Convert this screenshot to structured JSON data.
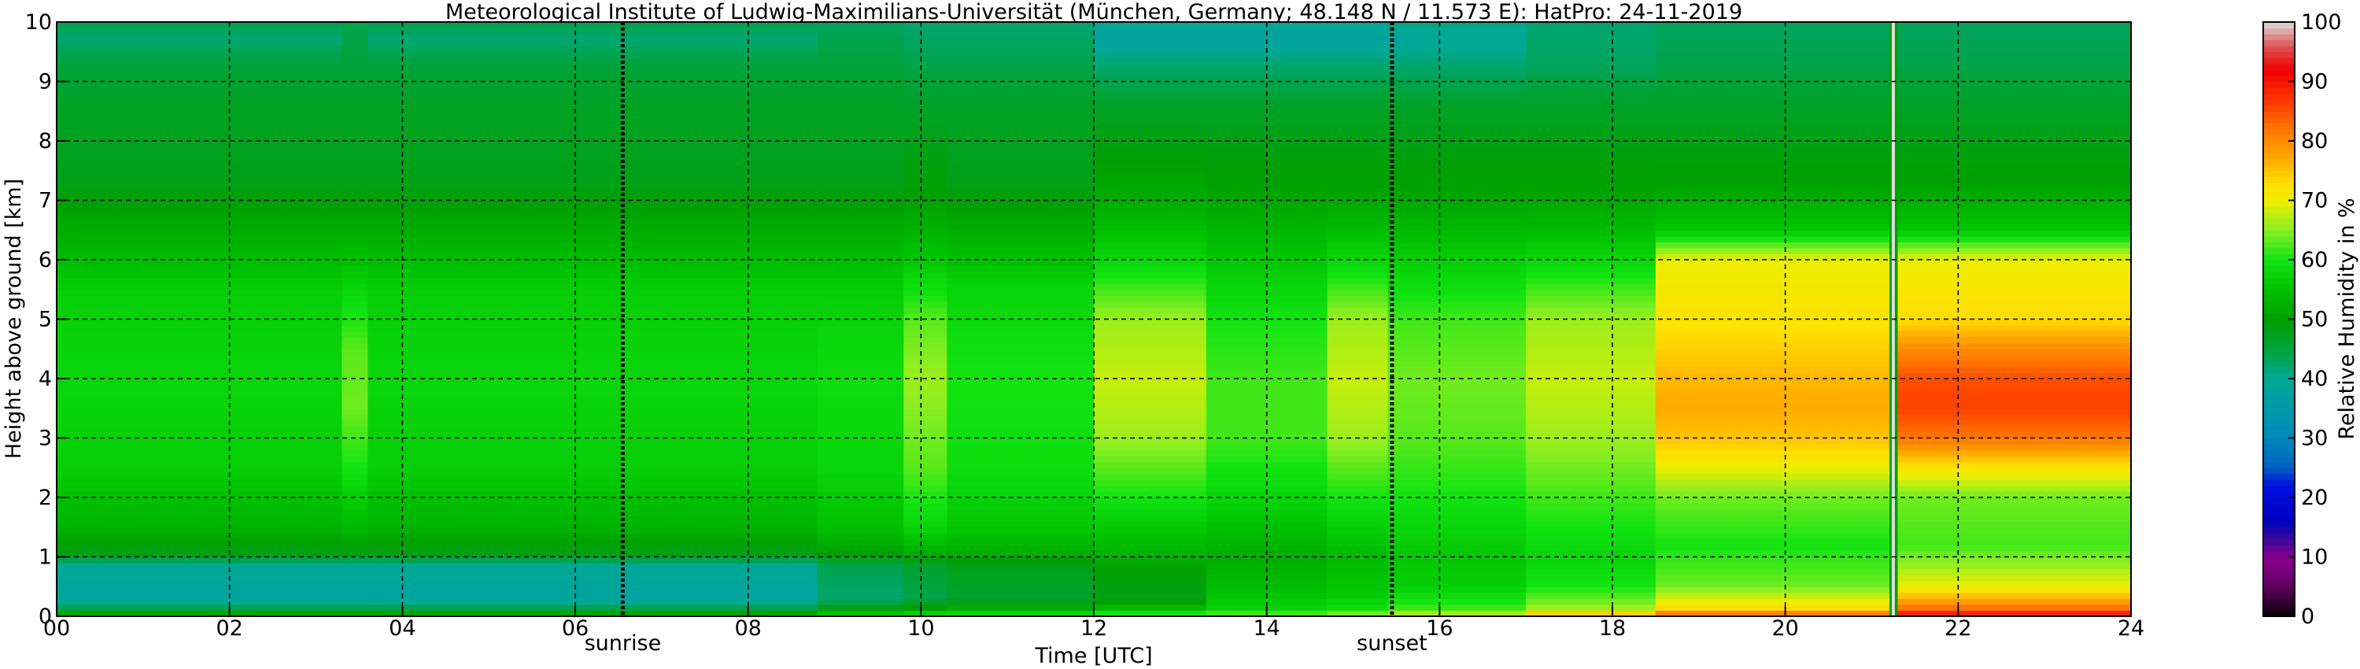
{
  "chart_data": {
    "type": "heatmap",
    "title": "Meteorological Institute of Ludwig-Maximilians-Universität (München, Germany; 48.148 N / 11.573 E):    HatPro: 24-11-2019",
    "xlabel": "Time [UTC]",
    "ylabel": "Height above ground [km]",
    "xlim": [
      0,
      24
    ],
    "ylim": [
      0,
      10
    ],
    "x_ticks": [
      "00",
      "02",
      "04",
      "06",
      "08",
      "10",
      "12",
      "14",
      "16",
      "18",
      "20",
      "22",
      "24"
    ],
    "y_ticks": [
      "0",
      "1",
      "2",
      "3",
      "4",
      "5",
      "6",
      "7",
      "8",
      "9",
      "10"
    ],
    "grid": true,
    "event_markers": [
      {
        "label": "sunrise",
        "time": 6.55
      },
      {
        "label": "sunset",
        "time": 15.45
      }
    ],
    "data_gap": {
      "time": 21.25
    },
    "colorbar": {
      "label": "Relative Humidity in %",
      "ticks": [
        "0",
        "10",
        "20",
        "30",
        "40",
        "50",
        "60",
        "70",
        "80",
        "90",
        "100"
      ],
      "range": [
        0,
        100
      ]
    },
    "colormap": [
      [
        0,
        "#000000"
      ],
      [
        2,
        "#2a002a"
      ],
      [
        6,
        "#6b006b"
      ],
      [
        10,
        "#8a0090"
      ],
      [
        13,
        "#3a0a9a"
      ],
      [
        16,
        "#0000c0"
      ],
      [
        22,
        "#0010e0"
      ],
      [
        25,
        "#0060c0"
      ],
      [
        30,
        "#0088bb"
      ],
      [
        35,
        "#009aaa"
      ],
      [
        40,
        "#00a895"
      ],
      [
        45,
        "#00a33a"
      ],
      [
        50,
        "#00a000"
      ],
      [
        55,
        "#00c000"
      ],
      [
        60,
        "#11e311"
      ],
      [
        65,
        "#88ee22"
      ],
      [
        70,
        "#eeee00"
      ],
      [
        73,
        "#ffdd00"
      ],
      [
        77,
        "#ffaa00"
      ],
      [
        82,
        "#ff7700"
      ],
      [
        87,
        "#ff3300"
      ],
      [
        92,
        "#ee0000"
      ],
      [
        96,
        "#dd5555"
      ],
      [
        100,
        "#dddddd"
      ]
    ],
    "time_segments": [
      {
        "t": [
          0.0,
          3.3
        ],
        "profile": [
          [
            0,
            55
          ],
          [
            0.12,
            45
          ],
          [
            0.3,
            38
          ],
          [
            0.85,
            40
          ],
          [
            1.05,
            48
          ],
          [
            1.5,
            53
          ],
          [
            2.5,
            57
          ],
          [
            4,
            58
          ],
          [
            5.5,
            57
          ],
          [
            6.5,
            52
          ],
          [
            7.3,
            48
          ],
          [
            8.5,
            47
          ],
          [
            9.3,
            45
          ],
          [
            9.7,
            42
          ],
          [
            10,
            44
          ]
        ]
      },
      {
        "t": [
          3.3,
          3.6
        ],
        "profile": [
          [
            0,
            55
          ],
          [
            0.12,
            45
          ],
          [
            0.3,
            38
          ],
          [
            0.85,
            40
          ],
          [
            1.05,
            48
          ],
          [
            1.5,
            54
          ],
          [
            2.5,
            60
          ],
          [
            3.5,
            64
          ],
          [
            4.5,
            63
          ],
          [
            5.5,
            58
          ],
          [
            6.5,
            52
          ],
          [
            7.3,
            48
          ],
          [
            8.5,
            47
          ],
          [
            9.3,
            45
          ],
          [
            10,
            44
          ]
        ]
      },
      {
        "t": [
          3.6,
          8.8
        ],
        "profile": [
          [
            0,
            55
          ],
          [
            0.12,
            45
          ],
          [
            0.3,
            38
          ],
          [
            0.85,
            40
          ],
          [
            1.05,
            48
          ],
          [
            1.5,
            53
          ],
          [
            2.5,
            57
          ],
          [
            4,
            58
          ],
          [
            5.5,
            57
          ],
          [
            6.5,
            52
          ],
          [
            7.3,
            48
          ],
          [
            8.5,
            47
          ],
          [
            9.3,
            45
          ],
          [
            9.7,
            42
          ],
          [
            10,
            44
          ]
        ]
      },
      {
        "t": [
          8.8,
          9.8
        ],
        "profile": [
          [
            0,
            60
          ],
          [
            0.1,
            50
          ],
          [
            0.3,
            42
          ],
          [
            0.85,
            44
          ],
          [
            1.05,
            50
          ],
          [
            1.5,
            55
          ],
          [
            2.5,
            58
          ],
          [
            4,
            59
          ],
          [
            5.5,
            57
          ],
          [
            6.5,
            52
          ],
          [
            7.3,
            48
          ],
          [
            8.5,
            47
          ],
          [
            9.3,
            45
          ],
          [
            10,
            43
          ]
        ]
      },
      {
        "t": [
          9.8,
          10.3
        ],
        "profile": [
          [
            0,
            62
          ],
          [
            0.1,
            52
          ],
          [
            0.3,
            44
          ],
          [
            0.85,
            46
          ],
          [
            1.05,
            52
          ],
          [
            1.5,
            58
          ],
          [
            2.5,
            63
          ],
          [
            4,
            66
          ],
          [
            5,
            63
          ],
          [
            6,
            56
          ],
          [
            7,
            50
          ],
          [
            8.5,
            47
          ],
          [
            9.3,
            44
          ],
          [
            10,
            42
          ]
        ]
      },
      {
        "t": [
          10.3,
          12.0
        ],
        "profile": [
          [
            0,
            62
          ],
          [
            0.1,
            54
          ],
          [
            0.3,
            46
          ],
          [
            0.85,
            48
          ],
          [
            1.05,
            52
          ],
          [
            1.5,
            56
          ],
          [
            2.5,
            59
          ],
          [
            4,
            60
          ],
          [
            5.5,
            58
          ],
          [
            6.5,
            52
          ],
          [
            7.3,
            48
          ],
          [
            8.5,
            47
          ],
          [
            9.3,
            44
          ],
          [
            10,
            42
          ]
        ]
      },
      {
        "t": [
          12.0,
          13.3
        ],
        "profile": [
          [
            0,
            64
          ],
          [
            0.1,
            56
          ],
          [
            0.3,
            48
          ],
          [
            0.8,
            50
          ],
          [
            1.05,
            53
          ],
          [
            2,
            60
          ],
          [
            3,
            66
          ],
          [
            4,
            68
          ],
          [
            5,
            66
          ],
          [
            6,
            58
          ],
          [
            7,
            52
          ],
          [
            8.5,
            47
          ],
          [
            9.3,
            42
          ],
          [
            9.7,
            38
          ],
          [
            10,
            40
          ]
        ]
      },
      {
        "t": [
          13.3,
          14.7
        ],
        "profile": [
          [
            0,
            66
          ],
          [
            0.1,
            58
          ],
          [
            0.4,
            55
          ],
          [
            1,
            52
          ],
          [
            2,
            58
          ],
          [
            3,
            62
          ],
          [
            4,
            62
          ],
          [
            5,
            60
          ],
          [
            6,
            56
          ],
          [
            7,
            51
          ],
          [
            8.5,
            47
          ],
          [
            9.3,
            42
          ],
          [
            9.7,
            38
          ],
          [
            10,
            40
          ]
        ]
      },
      {
        "t": [
          14.7,
          15.4
        ],
        "profile": [
          [
            0,
            68
          ],
          [
            0.1,
            60
          ],
          [
            0.4,
            56
          ],
          [
            1,
            54
          ],
          [
            2,
            60
          ],
          [
            3,
            66
          ],
          [
            4,
            68
          ],
          [
            5,
            66
          ],
          [
            6,
            58
          ],
          [
            7,
            51
          ],
          [
            8.5,
            47
          ],
          [
            9.3,
            42
          ],
          [
            9.7,
            38
          ],
          [
            10,
            40
          ]
        ]
      },
      {
        "t": [
          15.4,
          17.0
        ],
        "profile": [
          [
            0,
            70
          ],
          [
            0.12,
            62
          ],
          [
            0.5,
            57
          ],
          [
            1,
            56
          ],
          [
            2,
            60
          ],
          [
            3,
            63
          ],
          [
            4,
            64
          ],
          [
            5,
            62
          ],
          [
            6,
            57
          ],
          [
            7,
            51
          ],
          [
            8.5,
            47
          ],
          [
            9.3,
            42
          ],
          [
            9.7,
            39
          ],
          [
            10,
            41
          ]
        ]
      },
      {
        "t": [
          17.0,
          18.5
        ],
        "profile": [
          [
            0,
            78
          ],
          [
            0.15,
            66
          ],
          [
            0.5,
            60
          ],
          [
            1,
            58
          ],
          [
            2,
            62
          ],
          [
            3,
            66
          ],
          [
            4,
            68
          ],
          [
            5,
            66
          ],
          [
            6,
            58
          ],
          [
            7,
            51
          ],
          [
            8.5,
            47
          ],
          [
            9.3,
            43
          ],
          [
            10,
            42
          ]
        ]
      },
      {
        "t": [
          18.5,
          21.2
        ],
        "profile": [
          [
            0,
            85
          ],
          [
            0.15,
            73
          ],
          [
            0.5,
            64
          ],
          [
            1.2,
            60
          ],
          [
            2,
            64
          ],
          [
            2.5,
            70
          ],
          [
            3,
            75
          ],
          [
            3.5,
            77
          ],
          [
            4,
            76
          ],
          [
            5,
            72
          ],
          [
            6,
            70
          ],
          [
            6.5,
            56
          ],
          [
            7.3,
            50
          ],
          [
            8.5,
            47
          ],
          [
            9.3,
            44
          ],
          [
            10,
            43
          ]
        ]
      },
      {
        "t": [
          21.3,
          24.0
        ],
        "profile": [
          [
            0,
            92
          ],
          [
            0.15,
            82
          ],
          [
            0.5,
            70
          ],
          [
            1.2,
            62
          ],
          [
            2,
            64
          ],
          [
            2.5,
            72
          ],
          [
            3,
            82
          ],
          [
            3.5,
            86
          ],
          [
            4,
            85
          ],
          [
            4.5,
            80
          ],
          [
            5,
            73
          ],
          [
            6,
            70
          ],
          [
            6.5,
            56
          ],
          [
            7.3,
            50
          ],
          [
            8.5,
            47
          ],
          [
            9.3,
            44
          ],
          [
            10,
            43
          ]
        ]
      }
    ]
  }
}
